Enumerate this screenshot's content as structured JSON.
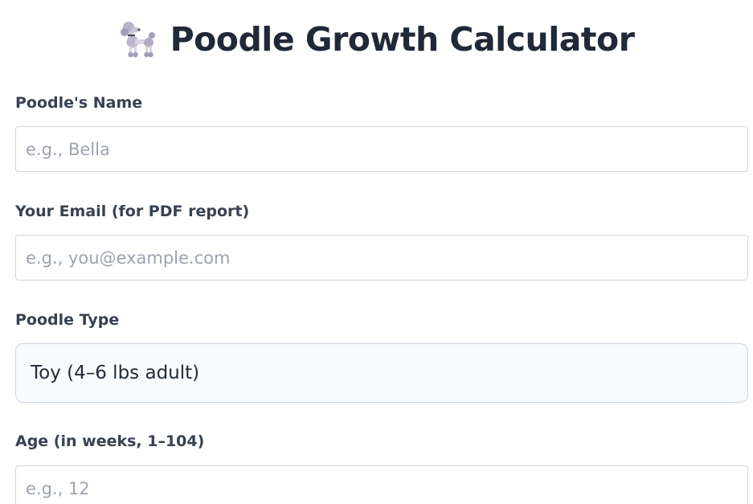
{
  "header": {
    "icon": "poodle-icon",
    "title": "Poodle Growth Calculator"
  },
  "form": {
    "name": {
      "label": "Poodle's Name",
      "placeholder": "e.g., Bella",
      "value": ""
    },
    "email": {
      "label": "Your Email (for PDF report)",
      "placeholder": "e.g., you@example.com",
      "value": ""
    },
    "poodle_type": {
      "label": "Poodle Type",
      "selected": "Toy (4–6 lbs adult)"
    },
    "age": {
      "label": "Age (in weeks, 1–104)",
      "placeholder": "e.g., 12",
      "value": ""
    }
  },
  "colors": {
    "title": "#1f2937",
    "label": "#374151",
    "input_border": "#d1d5db",
    "select_background": "#f8fafc",
    "placeholder": "#9ca3af"
  }
}
